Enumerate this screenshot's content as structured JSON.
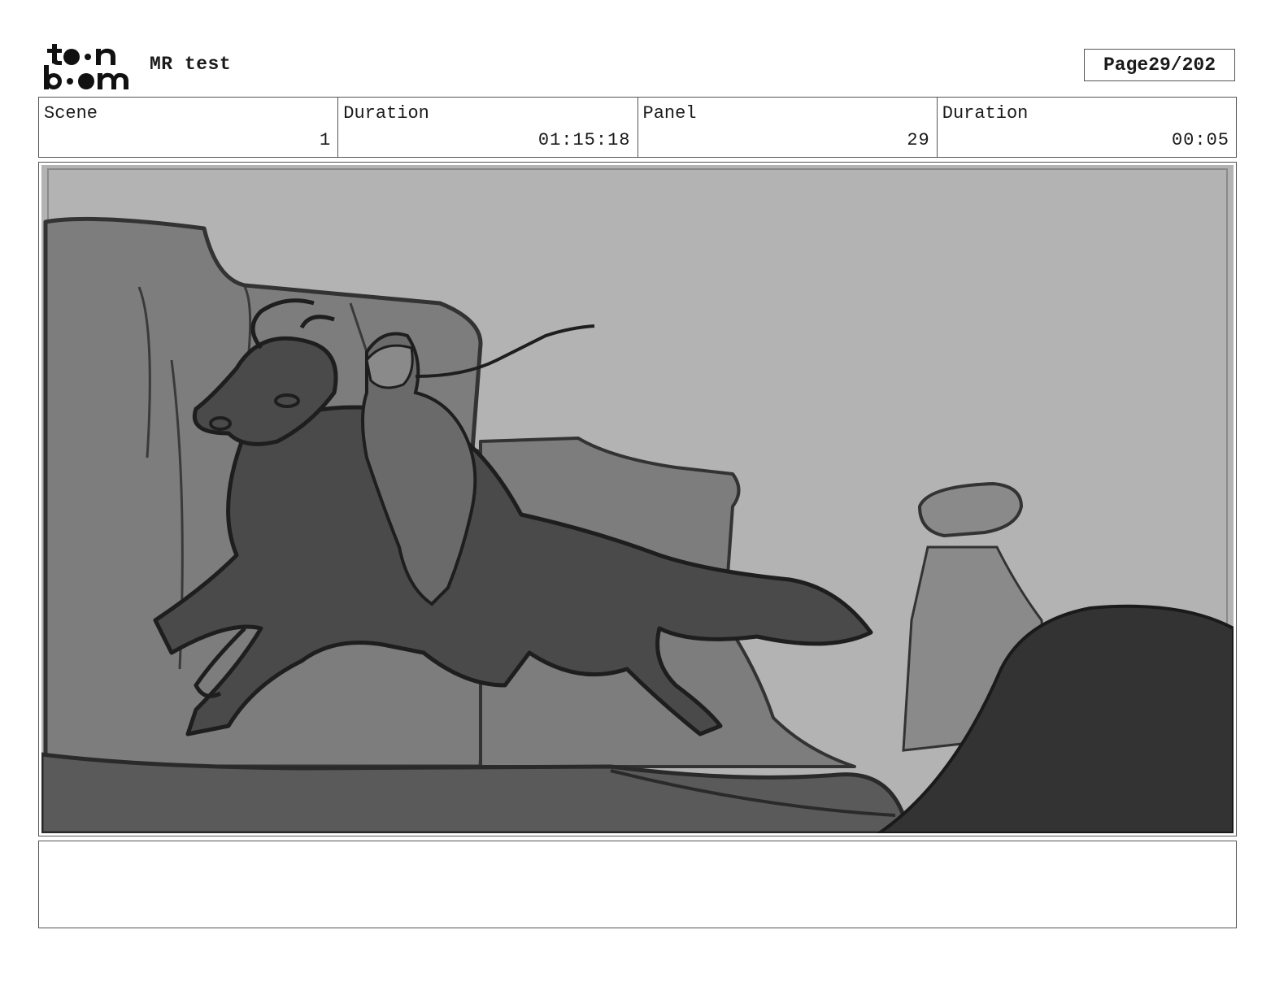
{
  "header": {
    "logo_name": "toonboom-logo",
    "project_title": "MR test",
    "page_label": "Page",
    "page_value": "29/202"
  },
  "info": {
    "scene_label": "Scene",
    "scene_value": "1",
    "scene_duration_label": "Duration",
    "scene_duration_value": "01:15:18",
    "panel_label": "Panel",
    "panel_value": "29",
    "panel_duration_label": "Duration",
    "panel_duration_value": "00:05"
  },
  "panel": {
    "image_description_icon": "storyboard-sketch",
    "colors": {
      "sky": "#b3b3b3",
      "cliffs": "#7d7d7d",
      "horse": "#4a4a4a",
      "ground": "#5a5a5a",
      "foreground_rock": "#333333"
    }
  },
  "notes": {
    "text": ""
  }
}
